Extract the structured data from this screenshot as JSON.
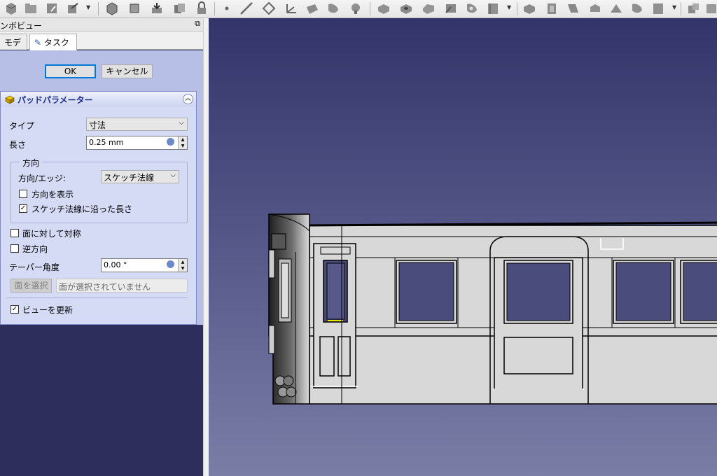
{
  "toolbar": {
    "icons": [
      "new-file-icon",
      "open-file-icon",
      "save-icon",
      "export-icon",
      "undo-icon",
      "dropdown-arrow-icon",
      "part-icon",
      "body-icon",
      "shape-binder-icon",
      "clone-icon",
      "lock-icon",
      "point-icon",
      "line-icon",
      "plane-icon",
      "lcs-icon",
      "pad-icon",
      "revolution-icon",
      "additive-loft-icon",
      "pocket-icon",
      "hole-icon",
      "groove-icon",
      "subtractive-pipe-icon",
      "additive-box-icon",
      "subtractive-box-icon",
      "fillet-icon",
      "chamfer-icon",
      "draft-icon",
      "thickness-icon",
      "mirrored-icon",
      "linear-pattern-icon"
    ]
  },
  "combo_view": {
    "title": "ンボビュー",
    "tabs": [
      {
        "label": "モデル",
        "active": false
      },
      {
        "label": "タスク",
        "active": true
      }
    ]
  },
  "dialog": {
    "ok_label": "OK",
    "cancel_label": "キャンセル",
    "panel_title": "パッドパラメーター",
    "type_label": "タイプ",
    "type_value": "寸法",
    "length_label": "長さ",
    "length_value": "0.25 mm",
    "direction_group_title": "方向",
    "direction_edge_label": "方向/エッジ:",
    "direction_edge_value": "スケッチ法線",
    "show_direction_label": "方向を表示",
    "show_direction_checked": false,
    "along_sketch_normal_label": "スケッチ法線に沿った長さ",
    "along_sketch_normal_checked": true,
    "symmetric_label": "面に対して対称",
    "symmetric_checked": false,
    "reversed_label": "逆方向",
    "reversed_checked": false,
    "taper_label": "テーパー角度",
    "taper_value": "0.00 °",
    "select_face_label": "面を選択",
    "face_placeholder": "面が選択されていません",
    "update_view_label": "ビューを更新",
    "update_view_checked": true
  },
  "colors": {
    "task_bg": "#b8bfe6",
    "panel_bg": "#d5daf5",
    "title_blue": "#1a2f8a",
    "view_top": "#33346a",
    "view_bottom": "#7a7ea6",
    "model_body": "#d8d8d8"
  }
}
